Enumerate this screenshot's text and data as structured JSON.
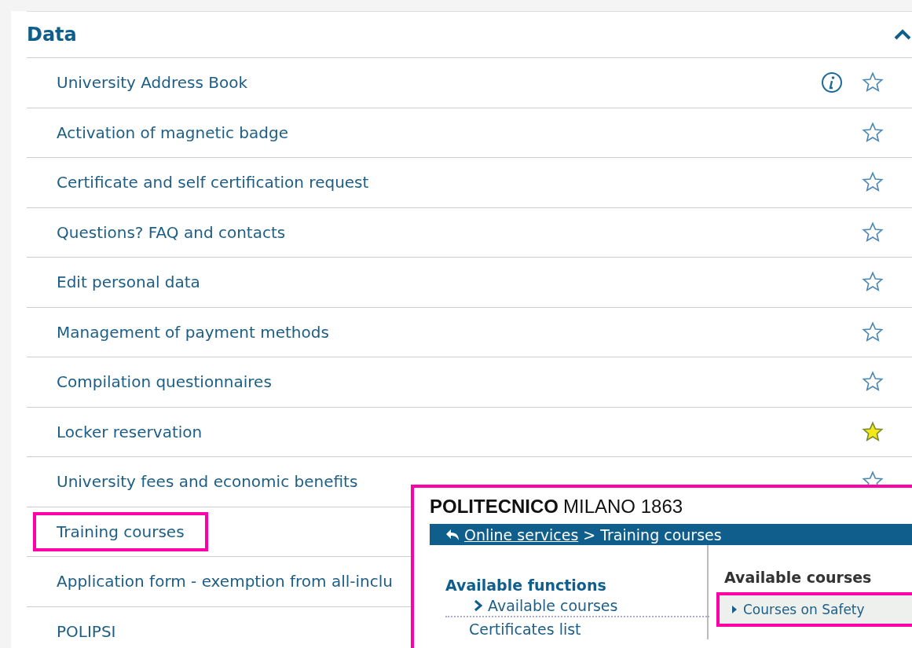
{
  "section": {
    "title": "Data",
    "expanded": true
  },
  "items": [
    {
      "label": "University Address Book",
      "info": true,
      "favorite": false
    },
    {
      "label": "Activation of magnetic badge",
      "info": false,
      "favorite": false
    },
    {
      "label": "Certificate and self certification request",
      "info": false,
      "favorite": false
    },
    {
      "label": "Questions? FAQ and contacts",
      "info": false,
      "favorite": false
    },
    {
      "label": "Edit personal data",
      "info": false,
      "favorite": false
    },
    {
      "label": "Management of payment methods",
      "info": false,
      "favorite": false
    },
    {
      "label": "Compilation questionnaires",
      "info": false,
      "favorite": false
    },
    {
      "label": "Locker reservation",
      "info": false,
      "favorite": true
    },
    {
      "label": "University fees and economic benefits",
      "info": false,
      "favorite": false
    },
    {
      "label": "Training courses",
      "highlighted": true
    },
    {
      "label": "Application form - exemption from all-inclu",
      "highlighted": false
    },
    {
      "label": "POLIPSI",
      "highlighted": false
    }
  ],
  "inset": {
    "logo_bold": "POLITECNICO",
    "logo_rest": "MILANO 1863",
    "breadcrumb": {
      "link": "Online services",
      "separator": ">",
      "current": "Training courses"
    },
    "functions": {
      "title": "Available functions",
      "items": [
        {
          "label": "Available courses",
          "selected": true
        },
        {
          "label": "Certificates list",
          "selected": false
        }
      ]
    },
    "courses": {
      "title": "Available courses",
      "items": [
        {
          "label": "Courses on Safety",
          "highlighted": true
        }
      ]
    }
  }
}
